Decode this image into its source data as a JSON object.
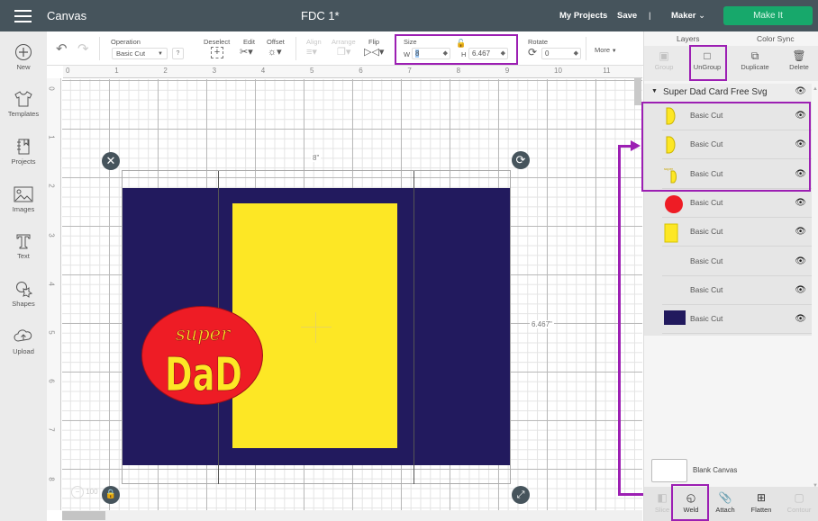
{
  "topbar": {
    "app_title": "Canvas",
    "doc_title": "FDC 1*",
    "my_projects": "My Projects",
    "save": "Save",
    "divider": "|",
    "machine": "Maker",
    "make_it": "Make It"
  },
  "leftnav": [
    {
      "label": "New",
      "icon": "plus-circle-icon"
    },
    {
      "label": "Templates",
      "icon": "tshirt-icon"
    },
    {
      "label": "Projects",
      "icon": "notebook-icon"
    },
    {
      "label": "Images",
      "icon": "image-icon"
    },
    {
      "label": "Text",
      "icon": "text-icon"
    },
    {
      "label": "Shapes",
      "icon": "shapes-icon"
    },
    {
      "label": "Upload",
      "icon": "cloud-upload-icon"
    }
  ],
  "toolbar": {
    "operation_label": "Operation",
    "operation_value": "Basic Cut",
    "help": "?",
    "deselect": "Deselect",
    "edit": "Edit",
    "offset": "Offset",
    "align": "Align",
    "arrange": "Arrange",
    "flip": "Flip",
    "size_label": "Size",
    "w_label": "W",
    "w_value": "8",
    "h_label": "H",
    "h_value": "6.467",
    "rotate_label": "Rotate",
    "rotate_value": "0",
    "more": "More"
  },
  "rulers": {
    "top": [
      "0",
      "1",
      "2",
      "3",
      "4",
      "5",
      "6",
      "7",
      "8",
      "9",
      "10",
      "11"
    ],
    "left": [
      "0",
      "1",
      "2",
      "3",
      "4",
      "5",
      "6",
      "7",
      "8"
    ]
  },
  "canvas": {
    "width_label": "8\"",
    "height_label": "6.467\"",
    "zoom_value": "100",
    "design_text_top": "super",
    "design_text_main": "DaD",
    "colors": {
      "navy": "#221a5e",
      "yellow": "#fde725",
      "red": "#ee1c25"
    }
  },
  "panel": {
    "tab_layers": "Layers",
    "tab_color_sync": "Color Sync",
    "actions": [
      {
        "label": "Group",
        "enabled": false
      },
      {
        "label": "UnGroup",
        "enabled": true
      },
      {
        "label": "Duplicate",
        "enabled": true
      },
      {
        "label": "Delete",
        "enabled": true
      }
    ],
    "group_name": "Super Dad Card Free Svg",
    "layers": [
      {
        "name": "Basic Cut",
        "thumb": "yellow-D"
      },
      {
        "name": "Basic Cut",
        "thumb": "yellow-D"
      },
      {
        "name": "Basic Cut",
        "thumb": "yellow-text"
      },
      {
        "name": "Basic Cut",
        "thumb": "red-circle"
      },
      {
        "name": "Basic Cut",
        "thumb": "yellow-rect"
      },
      {
        "name": "Basic Cut",
        "thumb": "none"
      },
      {
        "name": "Basic Cut",
        "thumb": "none"
      },
      {
        "name": "Basic Cut",
        "thumb": "navy-rect"
      }
    ],
    "blank_canvas": "Blank Canvas",
    "bottom_actions": [
      {
        "label": "Slice",
        "enabled": false
      },
      {
        "label": "Weld",
        "enabled": true
      },
      {
        "label": "Attach",
        "enabled": true
      },
      {
        "label": "Flatten",
        "enabled": true
      },
      {
        "label": "Contour",
        "enabled": false
      }
    ]
  },
  "annotation_color": "#9c1fb3"
}
